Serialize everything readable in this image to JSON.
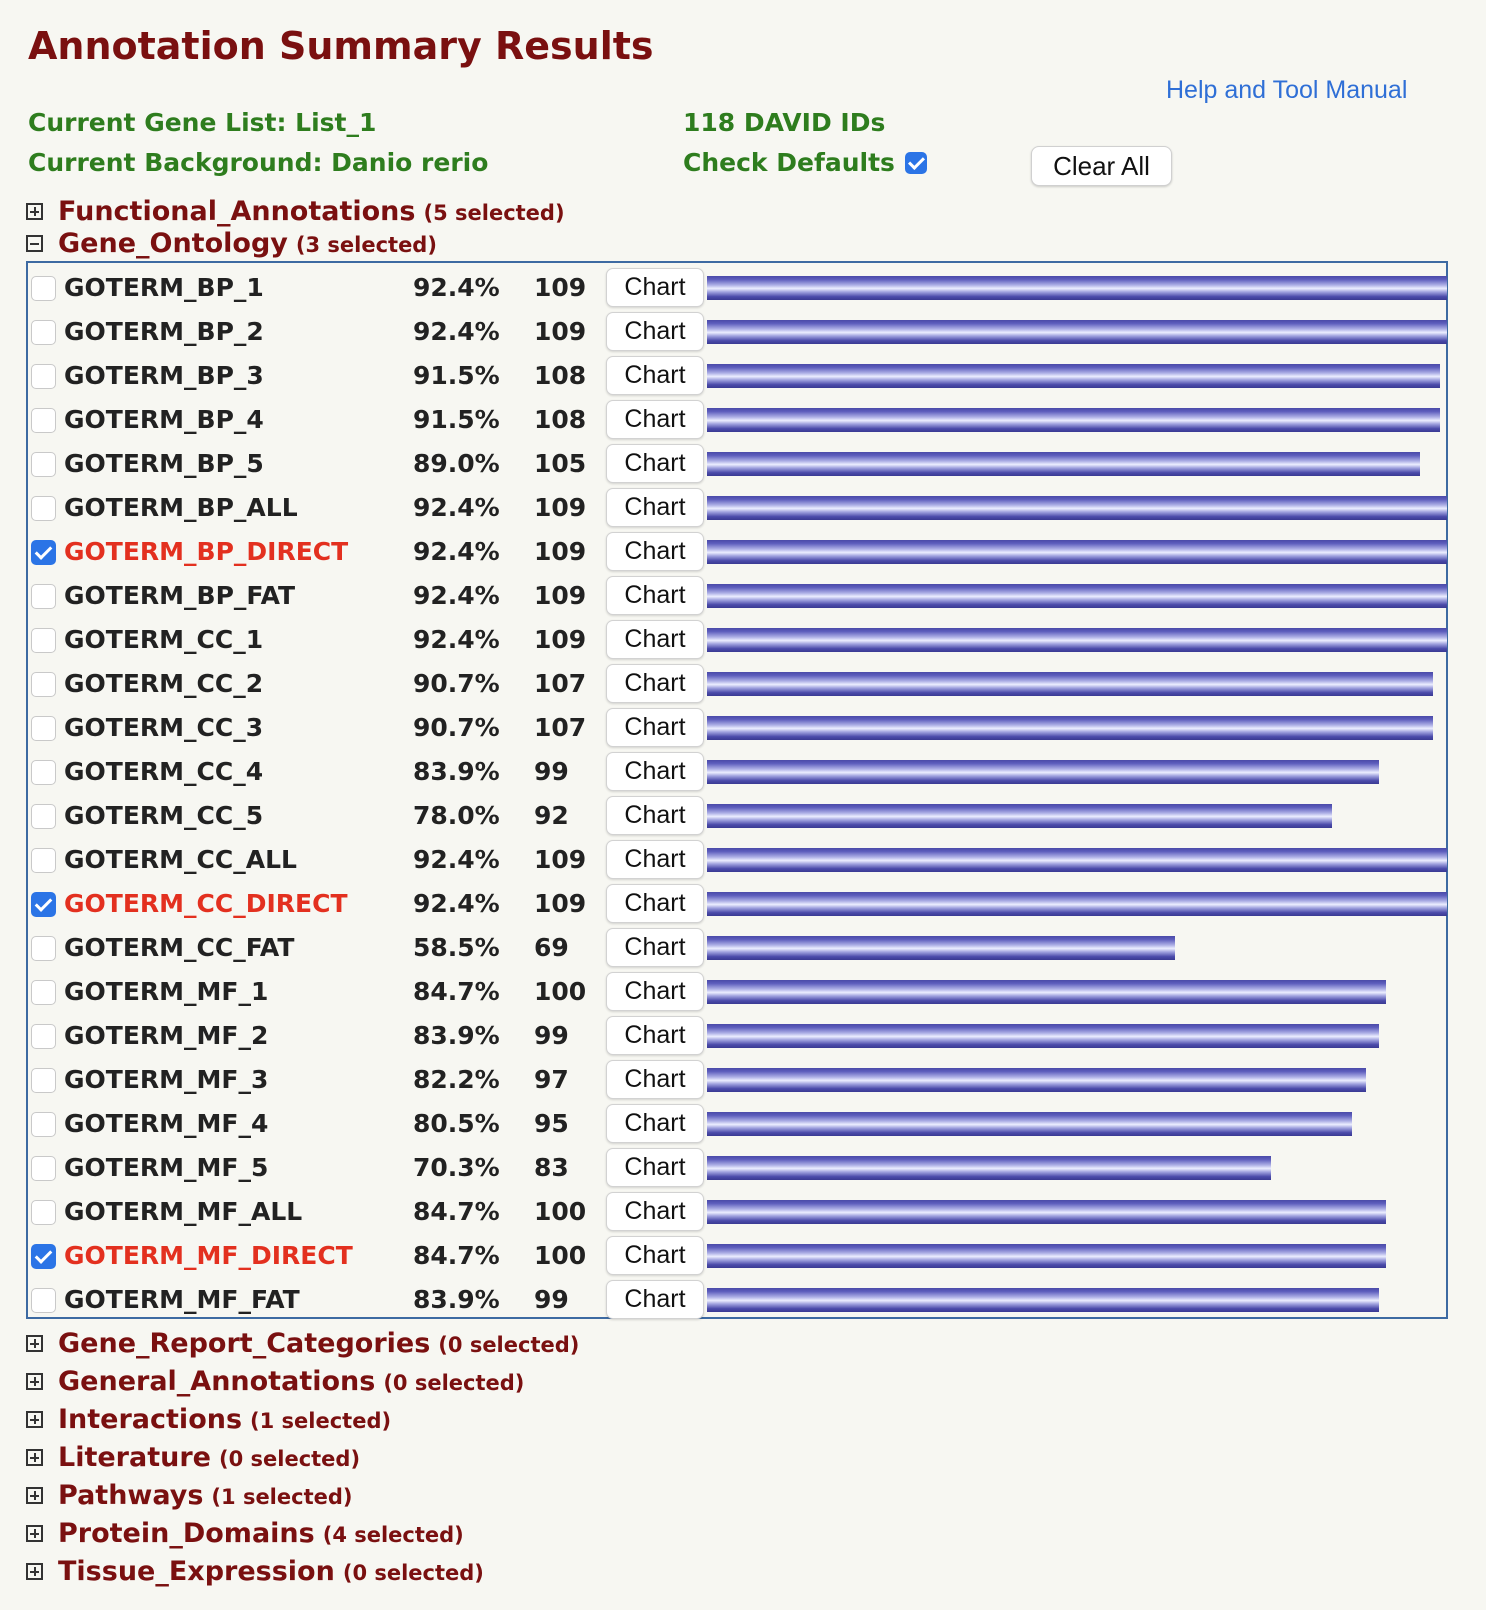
{
  "page": {
    "title": "Annotation Summary Results",
    "help_link": "Help and Tool Manual"
  },
  "info": {
    "gene_list": "Current Gene List: List_1",
    "background": "Current Background: Danio rerio",
    "david_ids": "118 DAVID IDs",
    "check_defaults_label": "Check Defaults",
    "check_defaults_checked": true,
    "clear_all_label": "Clear All"
  },
  "colors": {
    "title": "#7a1010",
    "info_text": "#2e7d1e",
    "link": "#2f6fd6",
    "selected_term": "#e3301f",
    "bar": "#4a4aa8",
    "table_border": "#3d6aa2"
  },
  "categories_before": [
    {
      "name": "Functional_Annotations",
      "count": "(5 selected)",
      "expanded": false
    }
  ],
  "gene_ontology": {
    "name": "Gene_Ontology",
    "count": "(3 selected)",
    "expanded": true,
    "chart_button_label": "Chart",
    "rows": [
      {
        "term": "GOTERM_BP_1",
        "pct": "92.4%",
        "count": "109",
        "checked": false,
        "bar_fraction": 1.0
      },
      {
        "term": "GOTERM_BP_2",
        "pct": "92.4%",
        "count": "109",
        "checked": false,
        "bar_fraction": 1.0
      },
      {
        "term": "GOTERM_BP_3",
        "pct": "91.5%",
        "count": "108",
        "checked": false,
        "bar_fraction": 0.9908
      },
      {
        "term": "GOTERM_BP_4",
        "pct": "91.5%",
        "count": "108",
        "checked": false,
        "bar_fraction": 0.9908
      },
      {
        "term": "GOTERM_BP_5",
        "pct": "89.0%",
        "count": "105",
        "checked": false,
        "bar_fraction": 0.9633
      },
      {
        "term": "GOTERM_BP_ALL",
        "pct": "92.4%",
        "count": "109",
        "checked": false,
        "bar_fraction": 1.0
      },
      {
        "term": "GOTERM_BP_DIRECT",
        "pct": "92.4%",
        "count": "109",
        "checked": true,
        "bar_fraction": 1.0
      },
      {
        "term": "GOTERM_BP_FAT",
        "pct": "92.4%",
        "count": "109",
        "checked": false,
        "bar_fraction": 1.0
      },
      {
        "term": "GOTERM_CC_1",
        "pct": "92.4%",
        "count": "109",
        "checked": false,
        "bar_fraction": 1.0
      },
      {
        "term": "GOTERM_CC_2",
        "pct": "90.7%",
        "count": "107",
        "checked": false,
        "bar_fraction": 0.9817
      },
      {
        "term": "GOTERM_CC_3",
        "pct": "90.7%",
        "count": "107",
        "checked": false,
        "bar_fraction": 0.9817
      },
      {
        "term": "GOTERM_CC_4",
        "pct": "83.9%",
        "count": "99",
        "checked": false,
        "bar_fraction": 0.9083
      },
      {
        "term": "GOTERM_CC_5",
        "pct": "78.0%",
        "count": "92",
        "checked": false,
        "bar_fraction": 0.844
      },
      {
        "term": "GOTERM_CC_ALL",
        "pct": "92.4%",
        "count": "109",
        "checked": false,
        "bar_fraction": 1.0
      },
      {
        "term": "GOTERM_CC_DIRECT",
        "pct": "92.4%",
        "count": "109",
        "checked": true,
        "bar_fraction": 1.0
      },
      {
        "term": "GOTERM_CC_FAT",
        "pct": "58.5%",
        "count": "69",
        "checked": false,
        "bar_fraction": 0.633
      },
      {
        "term": "GOTERM_MF_1",
        "pct": "84.7%",
        "count": "100",
        "checked": false,
        "bar_fraction": 0.9174
      },
      {
        "term": "GOTERM_MF_2",
        "pct": "83.9%",
        "count": "99",
        "checked": false,
        "bar_fraction": 0.9083
      },
      {
        "term": "GOTERM_MF_3",
        "pct": "82.2%",
        "count": "97",
        "checked": false,
        "bar_fraction": 0.8899
      },
      {
        "term": "GOTERM_MF_4",
        "pct": "80.5%",
        "count": "95",
        "checked": false,
        "bar_fraction": 0.8716
      },
      {
        "term": "GOTERM_MF_5",
        "pct": "70.3%",
        "count": "83",
        "checked": false,
        "bar_fraction": 0.7615
      },
      {
        "term": "GOTERM_MF_ALL",
        "pct": "84.7%",
        "count": "100",
        "checked": false,
        "bar_fraction": 0.9174
      },
      {
        "term": "GOTERM_MF_DIRECT",
        "pct": "84.7%",
        "count": "100",
        "checked": true,
        "bar_fraction": 0.9174
      },
      {
        "term": "GOTERM_MF_FAT",
        "pct": "83.9%",
        "count": "99",
        "checked": false,
        "bar_fraction": 0.9083
      }
    ]
  },
  "categories_after": [
    {
      "name": "Gene_Report_Categories",
      "count": "(0 selected)",
      "expanded": false
    },
    {
      "name": "General_Annotations",
      "count": "(0 selected)",
      "expanded": false
    },
    {
      "name": "Interactions",
      "count": "(1 selected)",
      "expanded": false
    },
    {
      "name": "Literature",
      "count": "(0 selected)",
      "expanded": false
    },
    {
      "name": "Pathways",
      "count": "(1 selected)",
      "expanded": false
    },
    {
      "name": "Protein_Domains",
      "count": "(4 selected)",
      "expanded": false
    },
    {
      "name": "Tissue_Expression",
      "count": "(0 selected)",
      "expanded": false
    }
  ]
}
